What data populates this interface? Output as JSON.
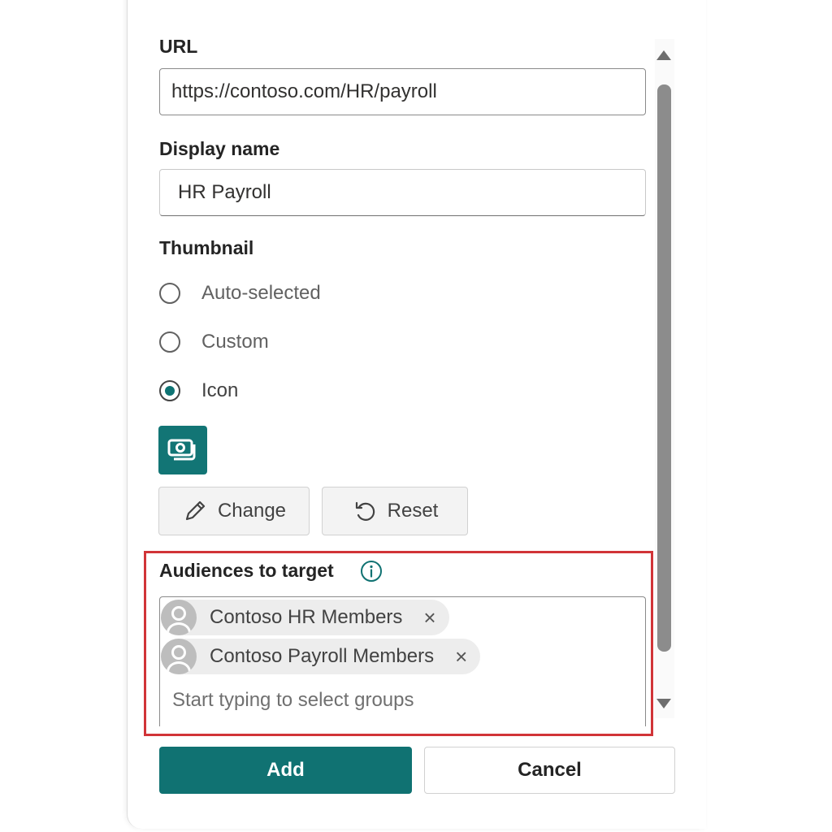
{
  "url_section": {
    "label": "URL",
    "value": "https://contoso.com/HR/payroll"
  },
  "display_name_section": {
    "label": "Display name",
    "value": "HR Payroll"
  },
  "thumbnail": {
    "label": "Thumbnail",
    "options": [
      {
        "label": "Auto-selected",
        "checked": false
      },
      {
        "label": "Custom",
        "checked": false
      },
      {
        "label": "Icon",
        "checked": true
      }
    ],
    "selected_icon": "money-icon",
    "change_label": "Change",
    "reset_label": "Reset"
  },
  "audiences": {
    "label": "Audiences to target",
    "info_icon": "info-icon",
    "groups": [
      {
        "name": "Contoso HR Members",
        "remove": "×"
      },
      {
        "name": "Contoso Payroll Members",
        "remove": "×"
      }
    ],
    "placeholder": "Start typing to select groups"
  },
  "footer": {
    "add_label": "Add",
    "cancel_label": "Cancel"
  },
  "colors": {
    "accent": "#107272",
    "highlight": "#d13438"
  }
}
